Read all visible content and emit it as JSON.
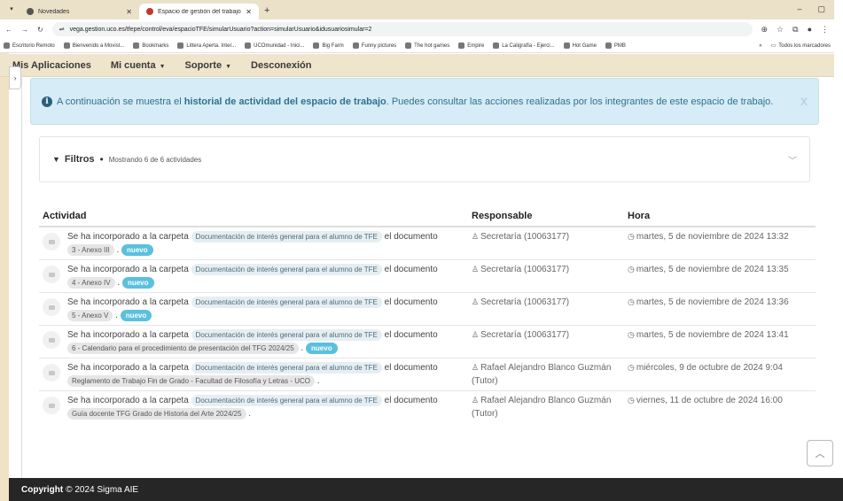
{
  "browser": {
    "tabs": [
      {
        "title": "Novedades",
        "active": false
      },
      {
        "title": "Espacio de gestión del trabajo",
        "active": true
      }
    ],
    "new_tab": "+",
    "url": "vega.gestion.uco.es/tfepe/control/eva/espacioTFE/simularUsuario?action=simularUsuario&idusuariosimular=2",
    "bookmarks": [
      "Escritorio Remoto",
      "Bienvenido a Movist...",
      "Bookmarks",
      "Littera Aperta. Inter...",
      "UCOmunidad - Inici...",
      "Big Farm",
      "Funny pictures",
      "The hot games",
      "Empire",
      "La Caligrafía - Ejerci...",
      "Hot Game",
      "PMB"
    ],
    "bookmarks_more": "»",
    "all_bookmarks": "Todos los marcadores"
  },
  "nav": {
    "items": [
      {
        "label": "Mis Aplicaciones",
        "dropdown": false
      },
      {
        "label": "Mi cuenta",
        "dropdown": true
      },
      {
        "label": "Soporte",
        "dropdown": true
      },
      {
        "label": "Desconexión",
        "dropdown": false
      }
    ]
  },
  "alert": {
    "before": "A continuación se muestra el ",
    "bold": "historial de actividad del espacio de trabajo",
    "after": ". Puedes consultar las acciones realizadas por los integrantes de este espacio de trabajo.",
    "close": "X"
  },
  "filters": {
    "label": "Filtros",
    "count": "Mostrando 6 de 6 actividades"
  },
  "table": {
    "headers": {
      "actividad": "Actividad",
      "responsable": "Responsable",
      "hora": "Hora"
    },
    "rows": [
      {
        "prefix": "Se ha incorporado a la carpeta",
        "folder": "Documentación de interés general para el alumno de TFE",
        "mid": "el documento",
        "doc": "3 - Anexo III",
        "nuevo": "nuevo",
        "resp": "Secretaría (10063177)",
        "hora": "martes, 5 de noviembre de 2024 13:32"
      },
      {
        "prefix": "Se ha incorporado a la carpeta",
        "folder": "Documentación de interés general para el alumno de TFE",
        "mid": "el documento",
        "doc": "4 - Anexo IV",
        "nuevo": "nuevo",
        "resp": "Secretaría (10063177)",
        "hora": "martes, 5 de noviembre de 2024 13:35"
      },
      {
        "prefix": "Se ha incorporado a la carpeta",
        "folder": "Documentación de interés general para el alumno de TFE",
        "mid": "el documento",
        "doc": "5 - Anexo V",
        "nuevo": "nuevo",
        "resp": "Secretaría (10063177)",
        "hora": "martes, 5 de noviembre de 2024 13:36"
      },
      {
        "prefix": "Se ha incorporado a la carpeta",
        "folder": "Documentación de interés general para el alumno de TFE",
        "mid": "el documento",
        "doc": "6 - Calendario para el procedimiento de presentación del TFG 2024/25",
        "nuevo": "nuevo",
        "resp": "Secretaría (10063177)",
        "hora": "martes, 5 de noviembre de 2024 13:41"
      },
      {
        "prefix": "Se ha incorporado a la carpeta",
        "folder": "Documentación de interés general para el alumno de TFE",
        "mid": "el documento",
        "doc": "Reglamento de Trabajo Fin de Grado - Facultad de Filosofía y Letras - UCO",
        "nuevo": "",
        "resp": "Rafael Alejandro Blanco Guzmán (Tutor)",
        "hora": "miércoles, 9 de octubre de 2024 9:04"
      },
      {
        "prefix": "Se ha incorporado a la carpeta",
        "folder": "Documentación de interés general para el alumno de TFE",
        "mid": "el documento",
        "doc": "Guía docente TFG Grado de Historia del Arte 2024/25",
        "nuevo": "",
        "resp": "Rafael Alejandro Blanco Guzmán (Tutor)",
        "hora": "viernes, 11 de octubre de 2024 16:00"
      }
    ]
  },
  "footer": {
    "bold": "Copyright",
    "text": "© 2024 Sigma AIE"
  },
  "colors": {
    "nav_bg": "#efe4cc",
    "alert_bg": "#d6ecf6",
    "alert_text": "#31708f",
    "badge_nuevo": "#5bc0de",
    "footer_bg": "#262626"
  }
}
